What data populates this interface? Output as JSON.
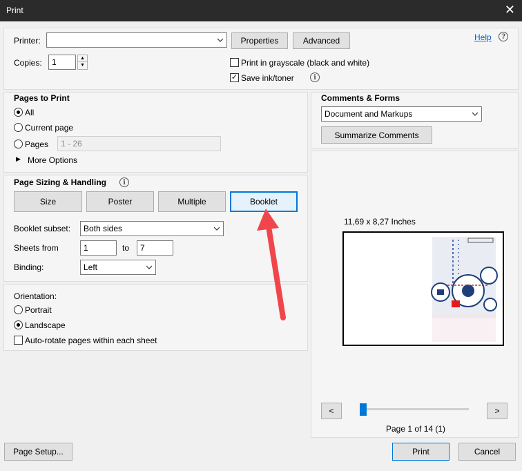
{
  "window": {
    "title": "Print",
    "close_glyph": "✕"
  },
  "printer": {
    "label": "Printer:",
    "value": "",
    "properties": "Properties",
    "advanced": "Advanced",
    "help": "Help",
    "help_icon": "?"
  },
  "copies": {
    "label": "Copies:",
    "value": "1"
  },
  "options": {
    "grayscale": {
      "label": "Print in grayscale (black and white)",
      "checked": false
    },
    "save_ink": {
      "label": "Save ink/toner",
      "checked": true
    }
  },
  "pages_to_print": {
    "heading": "Pages to Print",
    "all": "All",
    "current": "Current page",
    "pages": "Pages",
    "pages_value": "1 - 26",
    "more": "More Options"
  },
  "sizing": {
    "heading": "Page Sizing & Handling",
    "tabs": [
      "Size",
      "Poster",
      "Multiple",
      "Booklet"
    ],
    "active_tab": "Booklet",
    "booklet_subset_label": "Booklet subset:",
    "booklet_subset_value": "Both sides",
    "sheets_from_label": "Sheets from",
    "sheets_from": "1",
    "to_label": "to",
    "sheets_to": "7",
    "binding_label": "Binding:",
    "binding_value": "Left"
  },
  "orientation": {
    "heading": "Orientation:",
    "portrait": "Portrait",
    "landscape": "Landscape",
    "autorotate": "Auto-rotate pages within each sheet"
  },
  "comments": {
    "heading": "Comments & Forms",
    "value": "Document and Markups",
    "summarize": "Summarize Comments"
  },
  "preview": {
    "size": "11,69 x 8,27 Inches",
    "prev": "<",
    "next": ">",
    "page_info": "Page 1 of 14 (1)",
    "slider_position": 0
  },
  "footer": {
    "page_setup": "Page Setup...",
    "print": "Print",
    "cancel": "Cancel"
  },
  "colors": {
    "accent": "#0078d7",
    "arrow": "#f0464b"
  }
}
